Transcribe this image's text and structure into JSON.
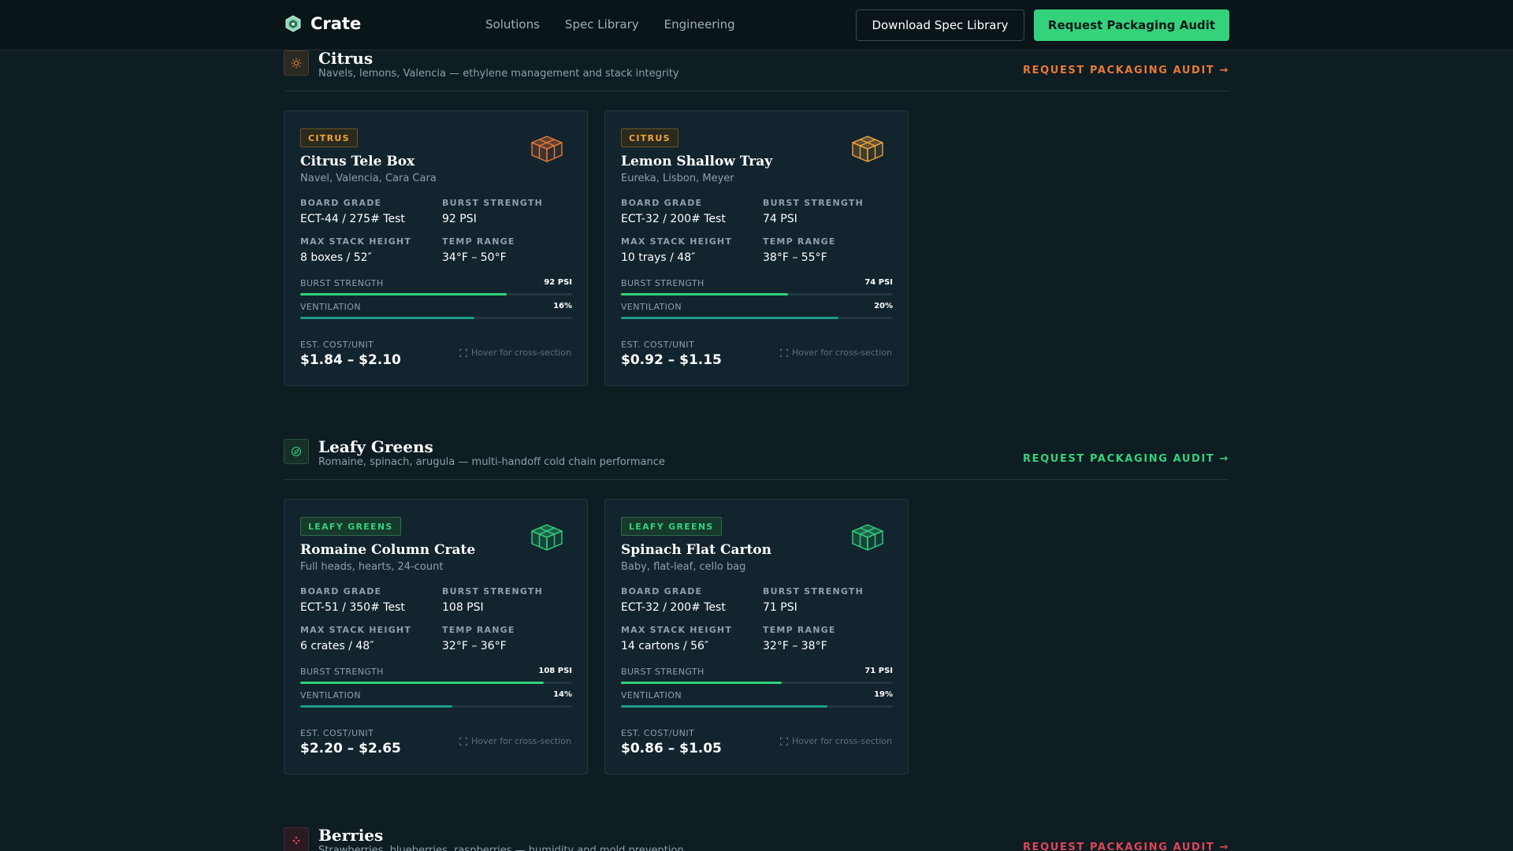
{
  "nav": {
    "brand": "Crate",
    "links": [
      "Solutions",
      "Spec Library",
      "Engineering"
    ],
    "download_label": "Download Spec Library",
    "cta_label": "Request Packaging Audit"
  },
  "colors": {
    "citrus": "#f0a53a",
    "citrus_accent": "#e8793a",
    "leafy": "#34d27b",
    "berries": "#e0445a",
    "ventilation": "#1f9a8a"
  },
  "sections": [
    {
      "title": "Citrus",
      "subtitle": "Navels, lemons, Valencia — ethylene management and stack integrity",
      "cta": "REQUEST PACKAGING AUDIT",
      "icon": "sun-icon",
      "cards": [
        {
          "tag": "CITRUS",
          "name": "Citrus Tele Box",
          "variety": "Navel, Valencia, Cara Cara",
          "board_grade_label": "BOARD GRADE",
          "board_grade": "ECT-44 / 275# Test",
          "burst_label": "BURST STRENGTH",
          "burst": "92 PSI",
          "stack_label": "MAX STACK HEIGHT",
          "stack": "8 boxes / 52″",
          "temp_label": "TEMP RANGE",
          "temp": "34°F – 50°F",
          "meter_burst_label": "BURST STRENGTH",
          "meter_burst_value": "92 PSI",
          "burst_fraction": 0.76,
          "meter_vent_label": "VENTILATION",
          "meter_vent_value": "16%",
          "vent_fraction": 0.64,
          "cost_label": "EST. COST/UNIT",
          "cost": "$1.84 – $2.10",
          "hint": "Hover for cross-section",
          "box_color": "#e8793a"
        },
        {
          "tag": "CITRUS",
          "name": "Lemon Shallow Tray",
          "variety": "Eureka, Lisbon, Meyer",
          "board_grade_label": "BOARD GRADE",
          "board_grade": "ECT-32 / 200# Test",
          "burst_label": "BURST STRENGTH",
          "burst": "74 PSI",
          "stack_label": "MAX STACK HEIGHT",
          "stack": "10 trays / 48″",
          "temp_label": "TEMP RANGE",
          "temp": "38°F – 55°F",
          "meter_burst_label": "BURST STRENGTH",
          "meter_burst_value": "74 PSI",
          "burst_fraction": 0.615,
          "meter_vent_label": "VENTILATION",
          "meter_vent_value": "20%",
          "vent_fraction": 0.8,
          "cost_label": "EST. COST/UNIT",
          "cost": "$0.92 – $1.15",
          "hint": "Hover for cross-section",
          "box_color": "#f0a53a"
        }
      ]
    },
    {
      "title": "Leafy Greens",
      "subtitle": "Romaine, spinach, arugula — multi-handoff cold chain performance",
      "cta": "REQUEST PACKAGING AUDIT",
      "icon": "leaf-icon",
      "cards": [
        {
          "tag": "LEAFY GREENS",
          "name": "Romaine Column Crate",
          "variety": "Full heads, hearts, 24-count",
          "board_grade_label": "BOARD GRADE",
          "board_grade": "ECT-51 / 350# Test",
          "burst_label": "BURST STRENGTH",
          "burst": "108 PSI",
          "stack_label": "MAX STACK HEIGHT",
          "stack": "6 crates / 48″",
          "temp_label": "TEMP RANGE",
          "temp": "32°F – 36°F",
          "meter_burst_label": "BURST STRENGTH",
          "meter_burst_value": "108 PSI",
          "burst_fraction": 0.895,
          "meter_vent_label": "VENTILATION",
          "meter_vent_value": "14%",
          "vent_fraction": 0.56,
          "cost_label": "EST. COST/UNIT",
          "cost": "$2.20 – $2.65",
          "hint": "Hover for cross-section",
          "box_color": "#34d27b"
        },
        {
          "tag": "LEAFY GREENS",
          "name": "Spinach Flat Carton",
          "variety": "Baby, flat-leaf, cello bag",
          "board_grade_label": "BOARD GRADE",
          "board_grade": "ECT-32 / 200# Test",
          "burst_label": "BURST STRENGTH",
          "burst": "71 PSI",
          "stack_label": "MAX STACK HEIGHT",
          "stack": "14 cartons / 56″",
          "temp_label": "TEMP RANGE",
          "temp": "32°F – 38°F",
          "meter_burst_label": "BURST STRENGTH",
          "meter_burst_value": "71 PSI",
          "burst_fraction": 0.59,
          "meter_vent_label": "VENTILATION",
          "meter_vent_value": "19%",
          "vent_fraction": 0.76,
          "cost_label": "EST. COST/UNIT",
          "cost": "$0.86 – $1.05",
          "hint": "Hover for cross-section",
          "box_color": "#34d27b"
        }
      ]
    },
    {
      "title": "Berries",
      "subtitle": "Strawberries, blueberries, raspberries — humidity and mold prevention",
      "cta": "REQUEST PACKAGING AUDIT",
      "icon": "berry-icon"
    }
  ]
}
